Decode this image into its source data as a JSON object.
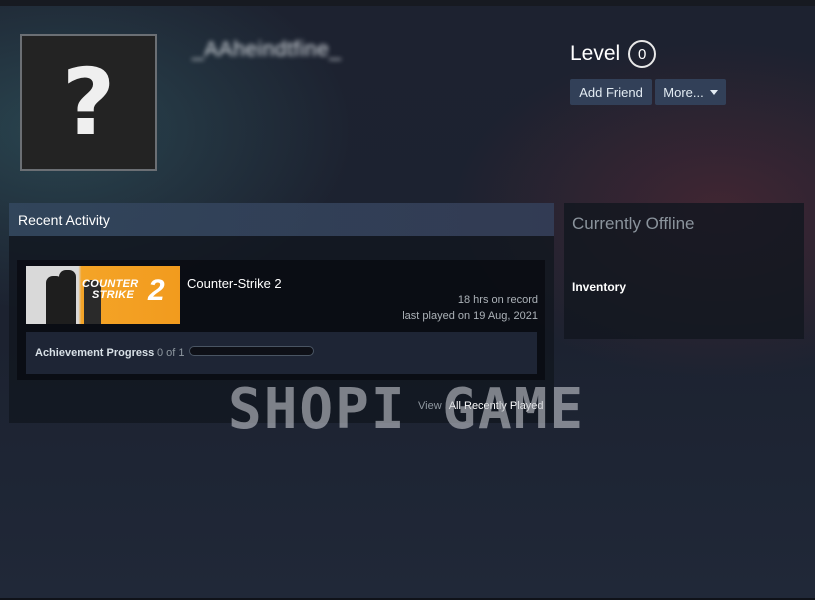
{
  "profile": {
    "persona_name": "_AAheindtfine_",
    "avatar_placeholder": "?",
    "level_label": "Level",
    "level_value": "0",
    "add_friend_label": "Add Friend",
    "more_label": "More..."
  },
  "recent_activity": {
    "title": "Recent Activity",
    "game": {
      "capsule_title_line1": "COUNTER",
      "capsule_title_line2": "STRIKE",
      "capsule_number": "2",
      "name": "Counter-Strike 2",
      "hours": "18 hrs on record",
      "last_played": "last played on 19 Aug, 2021",
      "achievement_label": "Achievement Progress",
      "achievement_count": "0 of 1",
      "achievement_progress": 0
    },
    "view_label": "View",
    "view_link": "All Recently Played"
  },
  "status_panel": {
    "title": "Currently Offline",
    "inventory_label": "Inventory"
  },
  "watermark": "SHOPI GAME",
  "colors": {
    "button_bg": "#324058",
    "capsule_orange": "#f29b1e",
    "offline_text": "#8a939c"
  },
  "icons": {
    "more_caret": "caret-down-icon"
  }
}
